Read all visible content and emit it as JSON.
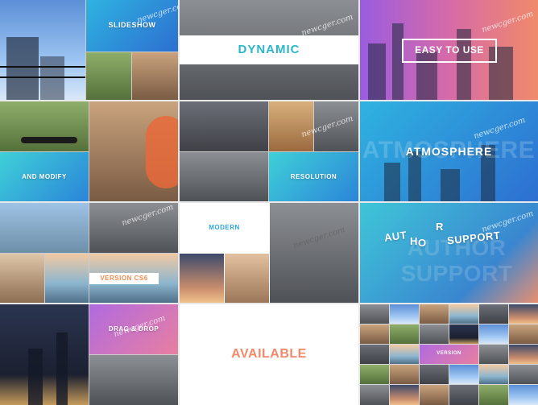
{
  "watermark": "newcger.com",
  "tiles": {
    "slideshow": {
      "label": "SLIDESHOW"
    },
    "dynamic": {
      "label": "DYNAMIC"
    },
    "easy": {
      "label": "EASY TO USE"
    },
    "modify": {
      "label": "AND MODIFY"
    },
    "resolution": {
      "label": "RESOLUTION"
    },
    "atmosphere": {
      "label": "ATMOSPHERE",
      "ghost": "ATMOSPHERE"
    },
    "modern": {
      "label": "MODERN"
    },
    "version": {
      "label": "VERSION CS6"
    },
    "support": {
      "line1a": "AUT",
      "line1b": "H",
      "line1c": "O",
      "line1d": "R",
      "line1e": "SUPPORT",
      "ghost": "AUTHOR SUPPORT"
    },
    "dragdrop": {
      "label": "DRAG & DROP"
    },
    "available": {
      "label": "AVAILABLE"
    },
    "collage": {
      "label": "VERSION"
    }
  },
  "colors": {
    "dynamic_text": "#2bb7c9",
    "available_gradient": [
      "#f06a7b",
      "#f7b35a"
    ],
    "version_text": "#f08a4f",
    "modern_text": "#2fa7d8"
  }
}
